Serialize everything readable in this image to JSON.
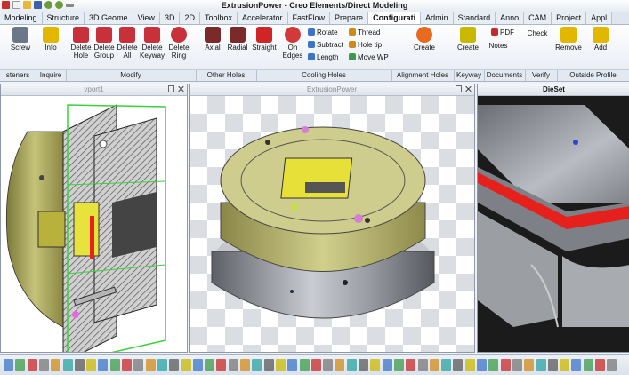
{
  "window": {
    "title": "ExtrusionPower - Creo Elements/Direct Modeling"
  },
  "tabs": [
    {
      "label": "Modeling"
    },
    {
      "label": "Structure"
    },
    {
      "label": "3D Geome"
    },
    {
      "label": "View"
    },
    {
      "label": "3D"
    },
    {
      "label": "2D"
    },
    {
      "label": "Toolbox"
    },
    {
      "label": "Accelerator"
    },
    {
      "label": "FastFlow"
    },
    {
      "label": "Prepare"
    },
    {
      "label": "Configurati"
    },
    {
      "label": "Admin"
    },
    {
      "label": "Standard"
    },
    {
      "label": "Anno"
    },
    {
      "label": "CAM"
    },
    {
      "label": "Project"
    },
    {
      "label": "Appl"
    }
  ],
  "active_tab": "Configurati",
  "ribbon": {
    "buttons": [
      {
        "label": "Screw",
        "icon": "screw-icon",
        "color": "#6b7788"
      },
      {
        "label": "Info",
        "icon": "info-question-icon",
        "color": "#e1b700"
      },
      {
        "label": "Delete\nHole",
        "icon": "delete-hole-icon",
        "color": "#c8303a"
      },
      {
        "label": "Delete\nGroup",
        "icon": "delete-group-icon",
        "color": "#c8303a"
      },
      {
        "label": "Delete\nAll",
        "icon": "delete-all-icon",
        "color": "#c8303a"
      },
      {
        "label": "Delete\nKeyway",
        "icon": "delete-keyway-icon",
        "color": "#c8303a"
      },
      {
        "label": "Delete\nRing",
        "icon": "delete-ring-icon",
        "color": "#c8303a"
      },
      {
        "label": "Axial",
        "icon": "axial-icon",
        "color": "#7b2a2a"
      },
      {
        "label": "Radial",
        "icon": "radial-icon",
        "color": "#7b2a2a"
      },
      {
        "label": "Straight",
        "icon": "straight-icon",
        "color": "#d02525"
      },
      {
        "label": "On\nEdges",
        "icon": "on-edges-icon",
        "color": "#d23a3a"
      },
      {
        "label": "Create",
        "icon": "create-cooling-icon",
        "color": "#e86a1e"
      },
      {
        "label": "Create",
        "icon": "create-keyway-icon",
        "color": "#c9b800"
      },
      {
        "label": "Notes",
        "icon": "notes-icon",
        "color": "#8b8b8b"
      },
      {
        "label": "Check",
        "icon": "check-icon",
        "color": "#3f7ad9"
      },
      {
        "label": "Remove",
        "icon": "remove-icon",
        "color": "#e1b700"
      },
      {
        "label": "Add",
        "icon": "add-icon",
        "color": "#e1b700"
      }
    ],
    "small_buttons": [
      {
        "label": "Rotate",
        "icon": "rotate-icon",
        "color": "#3c74c9"
      },
      {
        "label": "Subtract",
        "icon": "subtract-icon",
        "color": "#3c74c9"
      },
      {
        "label": "Length",
        "icon": "length-icon",
        "color": "#3c74c9"
      },
      {
        "label": "Thread",
        "icon": "thread-icon",
        "color": "#d08a1a"
      },
      {
        "label": "Hole tip",
        "icon": "hole-tip-icon",
        "color": "#d08a1a"
      },
      {
        "label": "Move WP",
        "icon": "move-wp-icon",
        "color": "#3c9a4a"
      },
      {
        "label": "PDF",
        "icon": "pdf-icon",
        "color": "#c82828"
      }
    ],
    "groups": [
      {
        "label": "steners"
      },
      {
        "label": "Inquire"
      },
      {
        "label": "Modify"
      },
      {
        "label": "Other Holes"
      },
      {
        "label": "Cooling Holes"
      },
      {
        "label": "Alignment Holes"
      },
      {
        "label": "Keyway"
      },
      {
        "label": "Documents"
      },
      {
        "label": "Verify"
      },
      {
        "label": "Outside Profile"
      }
    ]
  },
  "viewports": [
    {
      "title": "vport1",
      "active": false
    },
    {
      "title": "ExtrusionPower",
      "active": false
    },
    {
      "title": "DieSet",
      "active": true
    }
  ],
  "colors": {
    "accent": "#3c74c9",
    "tab_bar": "#dfe6ef",
    "die_olive": "#b9b96a",
    "die_steel": "#8d9096",
    "section_green": "#55d055",
    "highlight_red": "#e8231f"
  }
}
